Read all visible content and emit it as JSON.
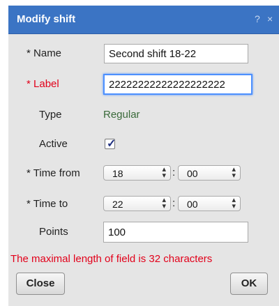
{
  "dialog": {
    "title": "Modify shift",
    "help_glyph": "?",
    "close_glyph": "×"
  },
  "form": {
    "name": {
      "required_mark": "*",
      "label": "Name",
      "value": "Second shift 18-22"
    },
    "label": {
      "required_mark": "*",
      "label": "Label",
      "value": "22222222222222222222"
    },
    "type": {
      "label": "Type",
      "value": "Regular"
    },
    "active": {
      "label": "Active",
      "checked": true
    },
    "time_from": {
      "required_mark": "*",
      "label": "Time from",
      "hour": "18",
      "minute": "00",
      "separator": ":"
    },
    "time_to": {
      "required_mark": "*",
      "label": "Time to",
      "hour": "22",
      "minute": "00",
      "separator": ":"
    },
    "points": {
      "label": "Points",
      "value": "100"
    }
  },
  "error_message": "The maximal length of field is 32 characters",
  "buttons": {
    "close": "Close",
    "ok": "OK"
  },
  "colors": {
    "titlebar": "#3b74c4",
    "error": "#e2001a",
    "type_value": "#3a6a3a",
    "dialog_bg": "#e5e5e5"
  }
}
